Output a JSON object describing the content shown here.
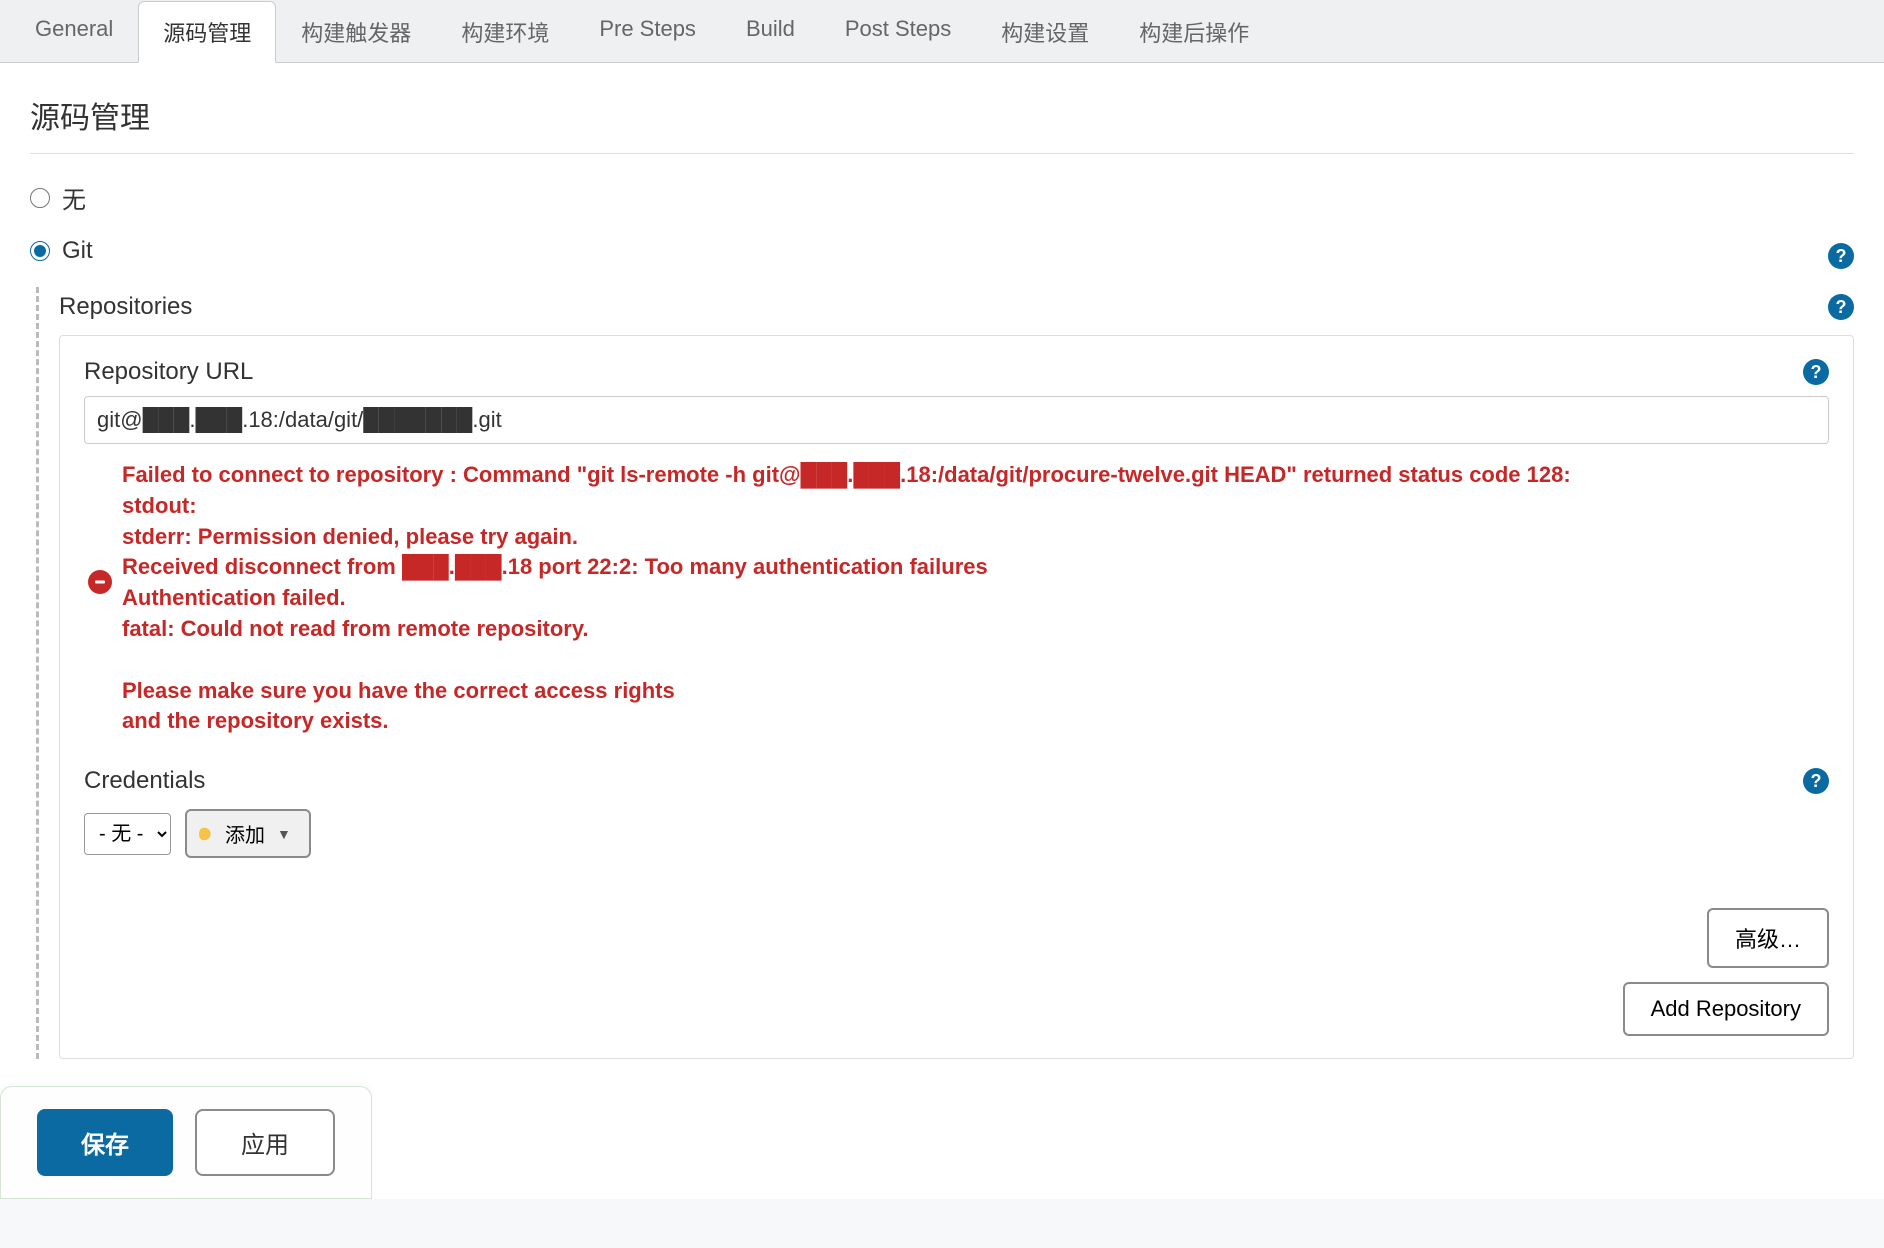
{
  "tabs": [
    {
      "id": "general",
      "label": "General",
      "active": false
    },
    {
      "id": "scm",
      "label": "源码管理",
      "active": true
    },
    {
      "id": "triggers",
      "label": "构建触发器",
      "active": false
    },
    {
      "id": "env",
      "label": "构建环境",
      "active": false
    },
    {
      "id": "presteps",
      "label": "Pre Steps",
      "active": false
    },
    {
      "id": "build",
      "label": "Build",
      "active": false
    },
    {
      "id": "poststeps",
      "label": "Post Steps",
      "active": false
    },
    {
      "id": "buildsettings",
      "label": "构建设置",
      "active": false
    },
    {
      "id": "postbuild",
      "label": "构建后操作",
      "active": false
    }
  ],
  "section_title": "源码管理",
  "scm_none_label": "无",
  "scm_git_label": "Git",
  "repositories_label": "Repositories",
  "repo_url_label": "Repository URL",
  "repo_url_value": "git@███.███.18:/data/git/███████.git",
  "error_text": " Failed to connect to repository : Command \"git ls-remote -h git@███.███.18:/data/git/procure-twelve.git HEAD\" returned status code 128:\nstdout:\nstderr: Permission denied, please try again.\nReceived disconnect from ███.███.18 port 22:2: Too many authentication failures\nAuthentication failed.\nfatal: Could not read from remote repository.\n\nPlease make sure you have the correct access rights\nand the repository exists.",
  "credentials_label": "Credentials",
  "credentials_selected": "- 无 -",
  "add_button_label": "添加",
  "advanced_button_label": "高级…",
  "add_repo_button_label": "Add Repository",
  "save_button_label": "保存",
  "apply_button_label": "应用",
  "help_glyph": "?"
}
